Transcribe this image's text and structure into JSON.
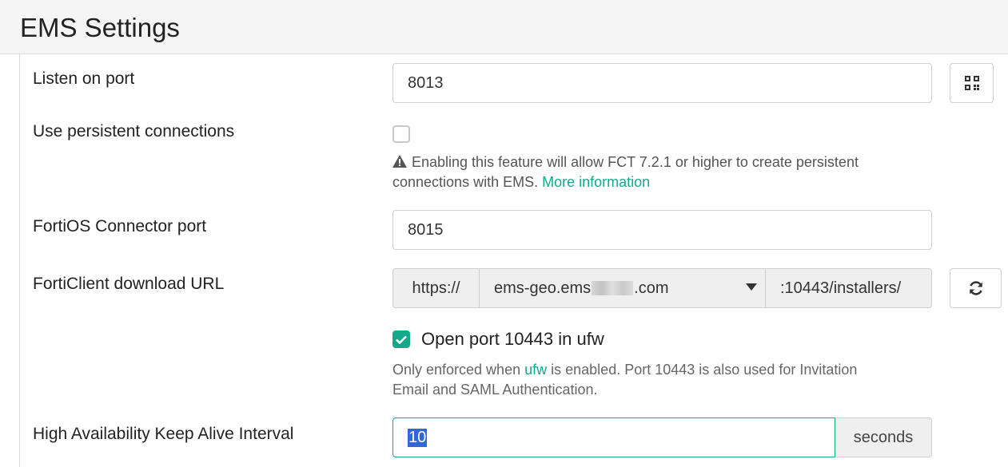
{
  "header": {
    "title": "EMS Settings"
  },
  "listen_port": {
    "label": "Listen on port",
    "value": "8013"
  },
  "persistent": {
    "label": "Use persistent connections",
    "checked": false,
    "warning_line1": "Enabling this feature will allow FCT 7.2.1 or higher to create persistent",
    "warning_line2": "connections with EMS.",
    "more_info": "More information"
  },
  "fortios_port": {
    "label": "FortiOS Connector port",
    "value": "8015"
  },
  "download_url": {
    "label": "FortiClient download URL",
    "prefix": "https://",
    "host_start": "ems-geo.ems",
    "host_end": ".com",
    "suffix": ":10443/installers/"
  },
  "ufw": {
    "checked": true,
    "label": "Open port 10443 in ufw",
    "note_prefix": "Only enforced when",
    "note_link": "ufw",
    "note_rest": "is enabled. Port 10443 is also used for Invitation",
    "note_line2": "Email and SAML Authentication."
  },
  "ha": {
    "label": "High Availability Keep Alive Interval",
    "value": "10",
    "unit": "seconds"
  },
  "colors": {
    "accent": "#14a98b",
    "selection": "#3367d6"
  },
  "icons": [
    "qr-code-icon",
    "warning-icon",
    "refresh-icon",
    "caret-down-icon",
    "checkmark-icon"
  ]
}
